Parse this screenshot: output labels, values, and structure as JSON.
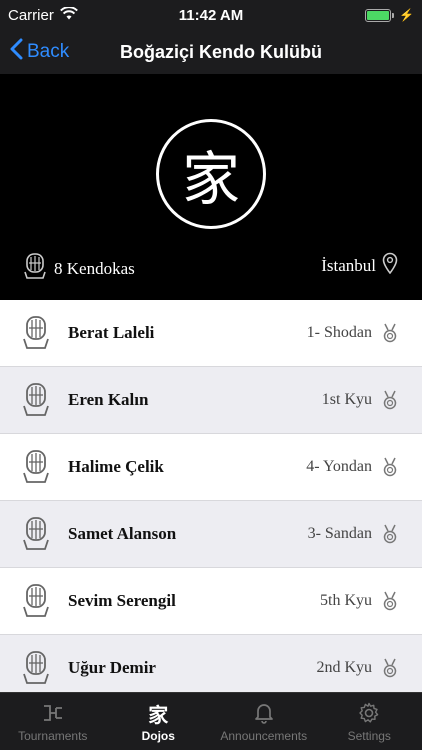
{
  "status_bar": {
    "carrier": "Carrier",
    "time": "11:42 AM",
    "battery_level": 1.0
  },
  "nav": {
    "back_label": "Back",
    "title": "Boğaziçi Kendo Kulübü"
  },
  "dojo": {
    "logo_glyph": "家",
    "kendoka_count": "8 Kendokas",
    "city": "İstanbul"
  },
  "members": [
    {
      "name": "Berat Laleli",
      "rank": "1- Shodan"
    },
    {
      "name": "Eren Kalın",
      "rank": "1st Kyu"
    },
    {
      "name": "Halime Çelik",
      "rank": "4- Yondan"
    },
    {
      "name": "Samet Alanson",
      "rank": "3- Sandan"
    },
    {
      "name": "Sevim Serengil",
      "rank": "5th Kyu"
    },
    {
      "name": "Uğur Demir",
      "rank": "2nd Kyu"
    }
  ],
  "tabs": [
    {
      "label": "Tournaments",
      "icon": "bracket-icon",
      "active": false
    },
    {
      "label": "Dojos",
      "icon": "dojo-glyph-icon",
      "glyph": "家",
      "active": true
    },
    {
      "label": "Announcements",
      "icon": "bell-icon",
      "active": false
    },
    {
      "label": "Settings",
      "icon": "gear-icon",
      "active": false
    }
  ],
  "colors": {
    "accent": "#2f8cff",
    "bar_bg": "#1c1c1e",
    "row_alt": "#ededf2",
    "battery": "#4cd964"
  }
}
